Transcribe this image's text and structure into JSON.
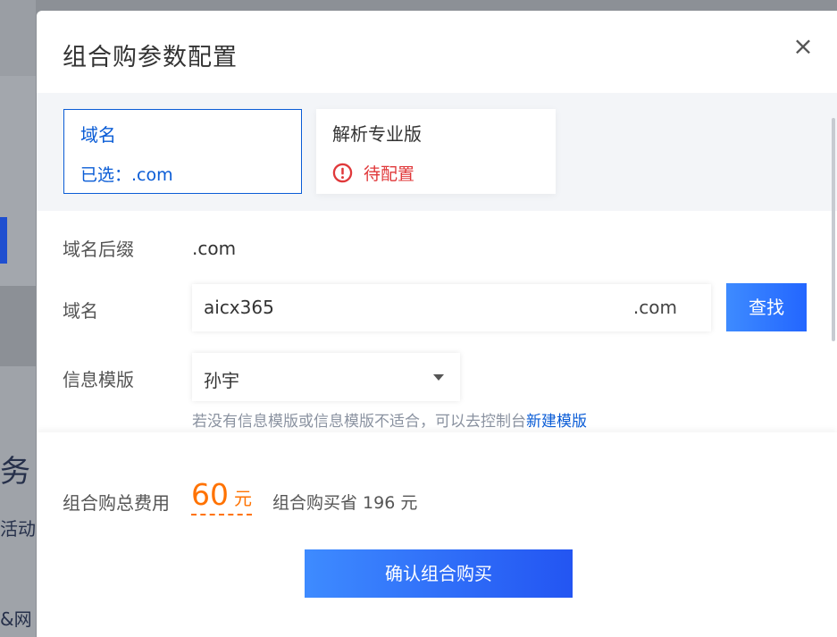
{
  "background": {
    "side_text_1": "务",
    "side_text_2": "活动",
    "side_text_3": "&网"
  },
  "modal": {
    "title": "组合购参数配置",
    "close_glyph": "×"
  },
  "products": [
    {
      "name": "域名",
      "status": "已选：.com"
    },
    {
      "name": "解析专业版",
      "status": "待配置",
      "status_icon": "warning-circle-icon"
    }
  ],
  "form": {
    "suffix_label": "域名后缀",
    "suffix_value": ".com",
    "domain_label": "域名",
    "domain_value": "aicx365",
    "domain_suffix": ".com",
    "search_button": "查找",
    "template_label": "信息模版",
    "template_value": "孙宇",
    "hint_text": "若没有信息模版或信息模版不适合，可以去控制台",
    "hint_link": "新建模版"
  },
  "footer": {
    "total_label": "组合购总费用",
    "total_amount": "60",
    "total_unit": "元",
    "save_text": "组合购买省 196 元",
    "confirm_button": "确认组合购买"
  },
  "colors": {
    "accent": "#0a5cd6",
    "warning": "#e0383a",
    "price": "#ff7200",
    "button_start": "#3e8bff",
    "button_end": "#2366ff"
  }
}
